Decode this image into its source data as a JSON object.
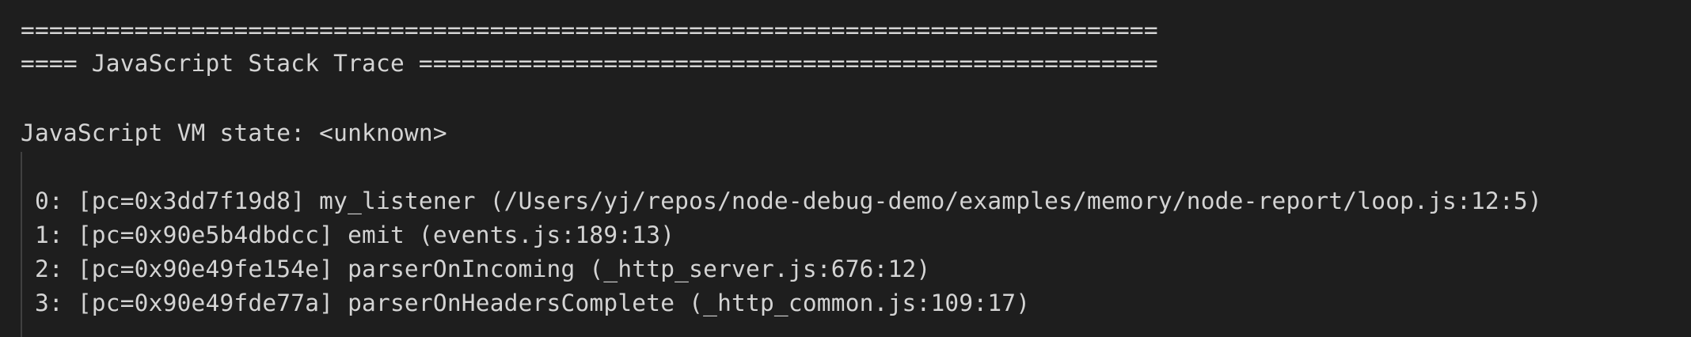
{
  "lines": [
    "================================================================================",
    "==== JavaScript Stack Trace ====================================================",
    "",
    "JavaScript VM state: <unknown>",
    "",
    " 0: [pc=0x3dd7f19d8] my_listener (/Users/yj/repos/node-debug-demo/examples/memory/node-report/loop.js:12:5)",
    " 1: [pc=0x90e5b4dbdcc] emit (events.js:189:13)",
    " 2: [pc=0x90e49fe154e] parserOnIncoming (_http_server.js:676:12)",
    " 3: [pc=0x90e49fde77a] parserOnHeadersComplete (_http_common.js:109:17)"
  ]
}
